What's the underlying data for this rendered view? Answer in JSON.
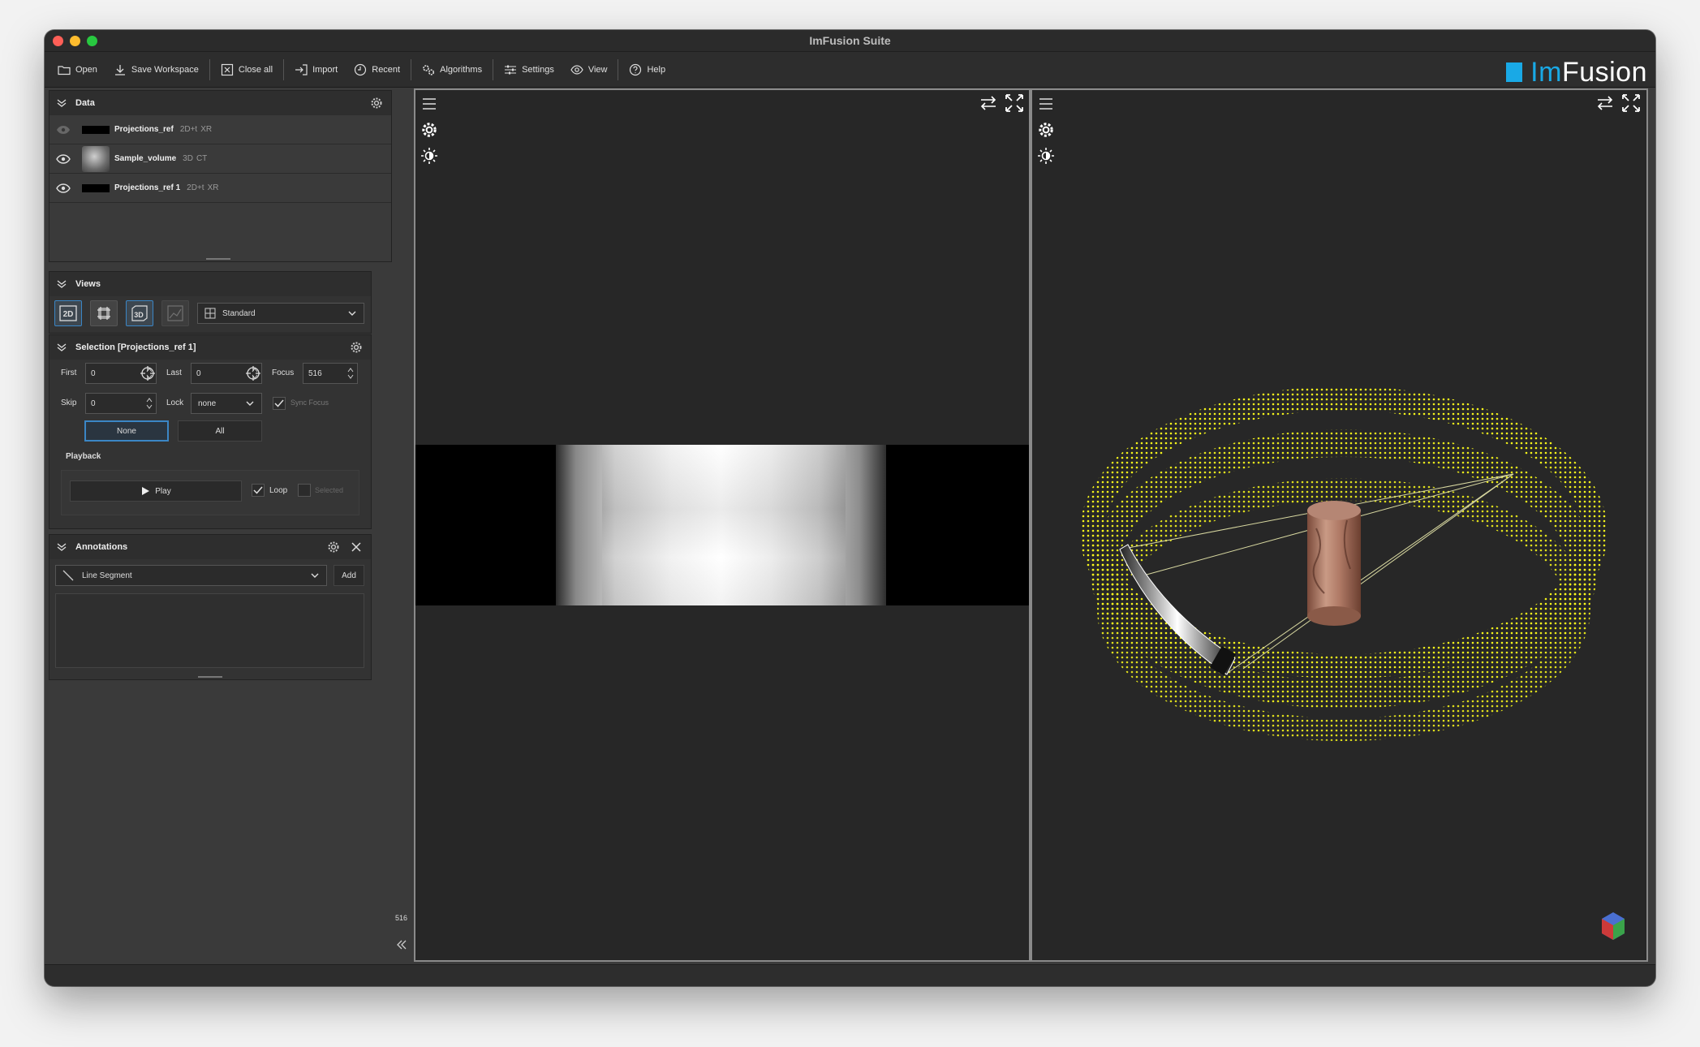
{
  "window": {
    "title": "ImFusion Suite"
  },
  "toolbar": {
    "open": "Open",
    "save_workspace": "Save Workspace",
    "close_all": "Close all",
    "import": "Import",
    "recent": "Recent",
    "algorithms": "Algorithms",
    "settings": "Settings",
    "view": "View",
    "help": "Help"
  },
  "logo": {
    "prefix": "Im",
    "suffix": "Fusion"
  },
  "data_panel": {
    "title": "Data",
    "items": [
      {
        "name": "Projections_ref",
        "dim": "2D+t",
        "modality": "XR"
      },
      {
        "name": "Sample_volume",
        "dim": "3D",
        "modality": "CT"
      },
      {
        "name": "Projections_ref 1",
        "dim": "2D+t",
        "modality": "XR"
      }
    ]
  },
  "views_panel": {
    "title": "Views",
    "layout": "Standard",
    "btn_2d": "2D",
    "btn_3d": "3D"
  },
  "selection_panel": {
    "title": "Selection [Projections_ref 1]",
    "first_label": "First",
    "first_value": "0",
    "last_label": "Last",
    "last_value": "0",
    "focus_label": "Focus",
    "focus_value": "516",
    "skip_label": "Skip",
    "skip_value": "0",
    "lock_label": "Lock",
    "lock_value": "none",
    "sync_focus": "Sync Focus",
    "none_btn": "None",
    "all_btn": "All",
    "playback_title": "Playback",
    "play_btn": "Play",
    "loop_label": "Loop",
    "selected_label": "Selected"
  },
  "annotations_panel": {
    "title": "Annotations",
    "tool": "Line Segment",
    "add_btn": "Add"
  },
  "scroll_value": "516",
  "colors": {
    "accent": "#19a9e6",
    "selection_border": "#3b86c5",
    "trajectory": "#ffff1a"
  }
}
